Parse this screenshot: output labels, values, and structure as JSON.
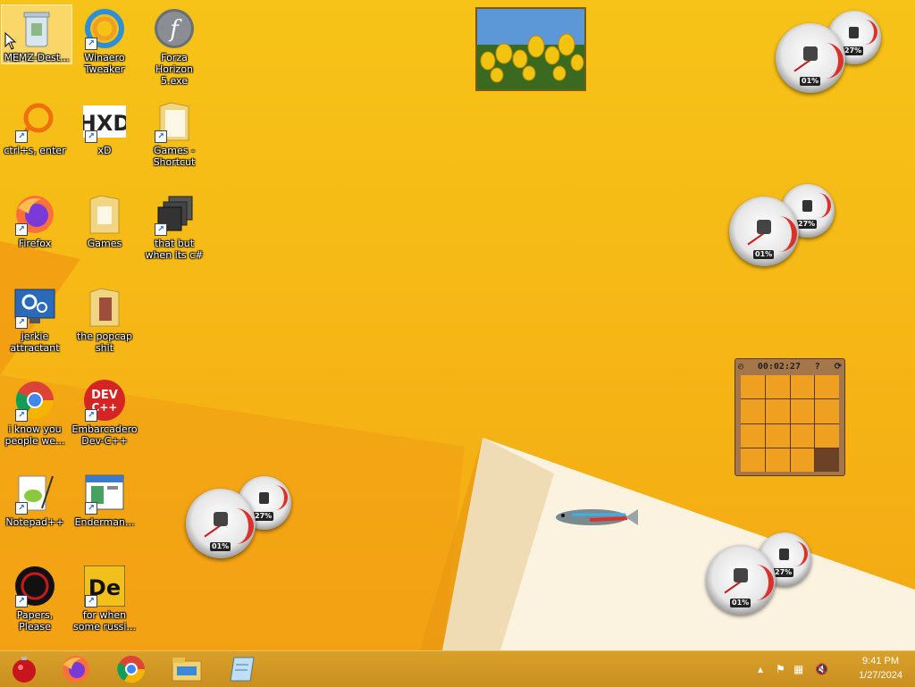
{
  "desktop": {
    "icons": [
      {
        "label": "MEMZ-Dest...",
        "icon": "recycle-bin-icon"
      },
      {
        "label": "Winaero Tweaker",
        "icon": "winaero-tweaker-icon"
      },
      {
        "label": "Forza Horizon 5.exe",
        "icon": "flash-icon"
      },
      {
        "label": "ctrl+s, enter",
        "icon": "search-icon"
      },
      {
        "label": "xD",
        "icon": "hxd-icon"
      },
      {
        "label": "Games - Shortcut",
        "icon": "folder-icon"
      },
      {
        "label": "Firefox",
        "icon": "firefox-icon"
      },
      {
        "label": "Games",
        "icon": "folder-icon"
      },
      {
        "label": "that but when its c#",
        "icon": "stacked-windows-icon"
      },
      {
        "label": "jerkie attractant",
        "icon": "settings-monitor-icon"
      },
      {
        "label": "the popcap shit",
        "icon": "folder-icon"
      },
      {
        "label": "i know you people we...",
        "icon": "chrome-icon"
      },
      {
        "label": "Embarcadero Dev-C++",
        "icon": "devcpp-icon"
      },
      {
        "label": "Notepad++",
        "icon": "notepadpp-icon"
      },
      {
        "label": "Enderman...",
        "icon": "window-app-icon"
      },
      {
        "label": "Papers, Please",
        "icon": "papers-please-icon"
      },
      {
        "label": "for when some russi...",
        "icon": "de-app-icon"
      }
    ]
  },
  "gadgets": {
    "meters": [
      {
        "cpu": "01%",
        "mem": "27%"
      },
      {
        "cpu": "01%",
        "mem": "27%"
      },
      {
        "cpu": "01%",
        "mem": "27%"
      },
      {
        "cpu": "01%",
        "mem": "27%"
      }
    ],
    "puzzle": {
      "timer": "00:02:27"
    },
    "slideshow": {
      "icon": "tulips-photo"
    }
  },
  "taskbar": {
    "start": {
      "icon": "start-ornament-icon"
    },
    "pinned": [
      {
        "icon": "firefox-icon"
      },
      {
        "icon": "chrome-icon"
      },
      {
        "icon": "file-explorer-icon"
      },
      {
        "icon": "notepad-icon"
      }
    ],
    "tray": {
      "time": "9:41 PM",
      "date": "1/27/2024"
    }
  },
  "colors": {
    "wallpaper": "#f6ba16",
    "taskbar": "#d9a02a"
  }
}
